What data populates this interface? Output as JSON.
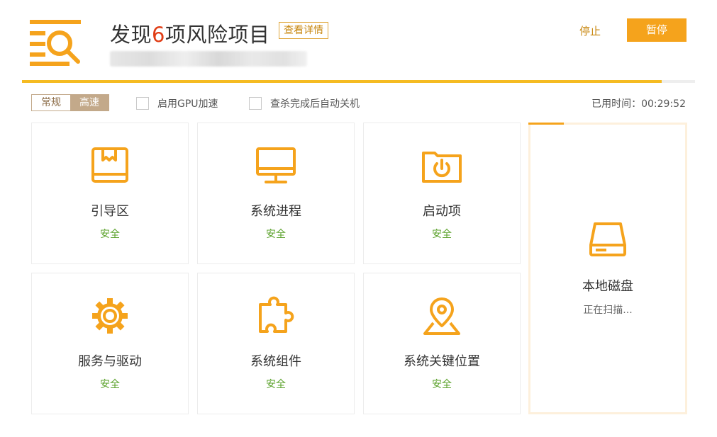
{
  "header": {
    "title_prefix": "发现",
    "title_count": "6",
    "title_suffix": "项风险项目",
    "details_label": "查看详情",
    "stop_label": "停止",
    "pause_label": "暂停",
    "progress": 0.95
  },
  "options": {
    "modes": [
      "常规",
      "高速"
    ],
    "active_mode": "高速",
    "gpu_label": "启用GPU加速",
    "shutdown_label": "查杀完成后自动关机",
    "elapsed_label": "已用时间：",
    "elapsed_value": "00:29:52"
  },
  "cards": [
    {
      "name": "引导区",
      "status": "安全",
      "icon": "bootloader-icon"
    },
    {
      "name": "系统进程",
      "status": "安全",
      "icon": "monitor-icon"
    },
    {
      "name": "启动项",
      "status": "安全",
      "icon": "power-folder-icon"
    },
    {
      "name": "本地磁盘",
      "status": "正在扫描...",
      "icon": "hard-disk-icon"
    },
    {
      "name": "服务与驱动",
      "status": "安全",
      "icon": "gear-icon"
    },
    {
      "name": "系统组件",
      "status": "安全",
      "icon": "puzzle-icon"
    },
    {
      "name": "系统关键位置",
      "status": "安全",
      "icon": "map-pin-icon"
    }
  ],
  "colors": {
    "accent": "#f5a31c",
    "safe": "#5aa12a",
    "risk_count": "#e03c14"
  }
}
